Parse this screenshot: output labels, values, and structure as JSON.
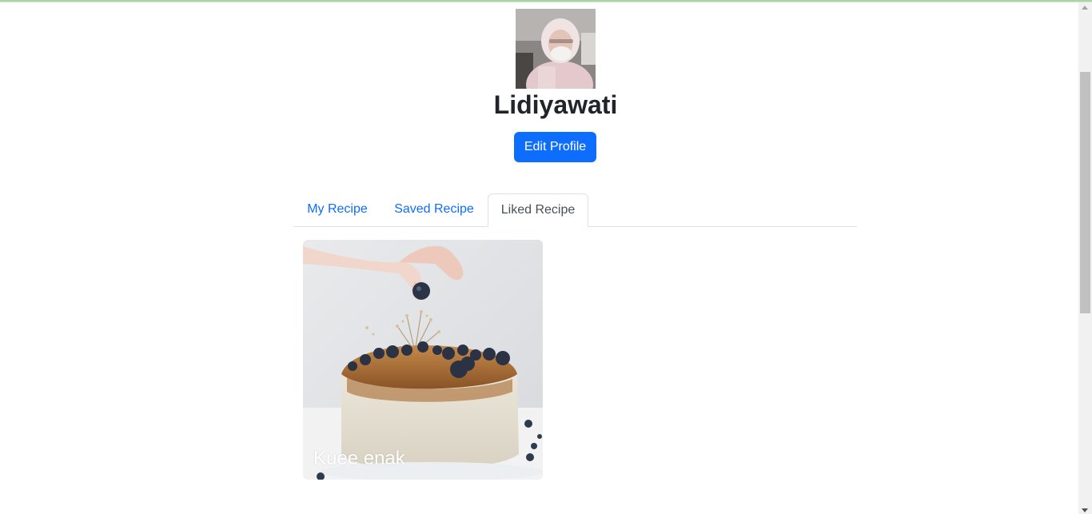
{
  "profile": {
    "name": "Lidiyawati",
    "edit_label": "Edit Profile"
  },
  "tabs": [
    {
      "label": "My Recipe",
      "active": false
    },
    {
      "label": "Saved Recipe",
      "active": false
    },
    {
      "label": "Liked Recipe",
      "active": true
    }
  ],
  "recipes": [
    {
      "title": "Kuee enak"
    }
  ],
  "colors": {
    "primary": "#0d6efd",
    "tab_active_text": "#495057",
    "border": "#dee2e6"
  }
}
